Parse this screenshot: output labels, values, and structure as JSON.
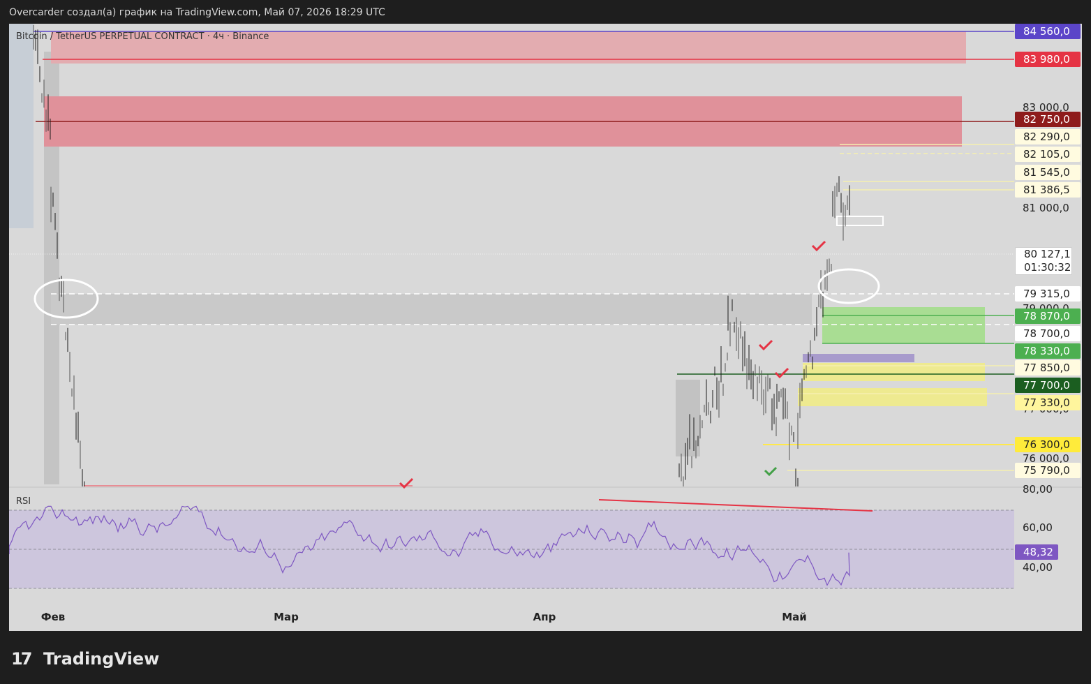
{
  "header": {
    "attribution": "Overcarder создал(а) график на TradingView.com, Май 07, 2026 18:29 UTC"
  },
  "chart": {
    "symbol_line": "Bitcoin / TetherUS PERPETUAL CONTRACT · 4ч · Binance",
    "indicator_label": "RSI",
    "months": [
      "Фев",
      "Мар",
      "Апр",
      "Май"
    ],
    "price_ticks": [
      "83 000,0",
      "81 000,0",
      "79 000,0",
      "77 000,0",
      "76 000,0"
    ],
    "rsi_ticks": [
      "80,00",
      "60,00",
      "40,00"
    ],
    "price_labels": [
      {
        "text": "84 560,0",
        "bg": "#5b45c8",
        "fg": "#ffffff"
      },
      {
        "text": "83 980,0",
        "bg": "#e53344",
        "fg": "#ffffff"
      },
      {
        "text": "82 750,0",
        "bg": "#8e1b1b",
        "fg": "#ffffff"
      },
      {
        "text": "82 290,0",
        "bg": "#fffbe0",
        "fg": "#222222"
      },
      {
        "text": "82 105,0",
        "bg": "#fffbe0",
        "fg": "#222222"
      },
      {
        "text": "81 545,0",
        "bg": "#fffbe0",
        "fg": "#222222"
      },
      {
        "text": "81 386,5",
        "bg": "#fffbe0",
        "fg": "#222222"
      },
      {
        "text": "79 315,0",
        "bg": "#ffffff",
        "fg": "#222222"
      },
      {
        "text": "78 870,0",
        "bg": "#4caf50",
        "fg": "#ffffff"
      },
      {
        "text": "78 700,0",
        "bg": "#ffffff",
        "fg": "#222222"
      },
      {
        "text": "78 330,0",
        "bg": "#4caf50",
        "fg": "#ffffff"
      },
      {
        "text": "77 850,0",
        "bg": "#fffbe0",
        "fg": "#222222"
      },
      {
        "text": "77 700,0",
        "bg": "#1b5e20",
        "fg": "#ffffff"
      },
      {
        "text": "77 330,0",
        "bg": "#fff59d",
        "fg": "#222222"
      },
      {
        "text": "76 300,0",
        "bg": "#ffeb3b",
        "fg": "#222222"
      },
      {
        "text": "75 790,0",
        "bg": "#fffbe0",
        "fg": "#222222"
      }
    ],
    "current_price": {
      "price": "80 127,1",
      "countdown": "01:30:32"
    },
    "rsi_value": {
      "text": "48,32",
      "bg": "#7e57c2"
    }
  },
  "chart_data": {
    "type": "line",
    "x_ticks": [
      "Фев",
      "Мар",
      "Апр",
      "Май"
    ],
    "ylim": [
      75600,
      85000
    ],
    "levels": [
      84560,
      83980,
      82750,
      82290,
      82105,
      81545,
      81386.5,
      79315,
      78870,
      78700,
      78330,
      77850,
      77700,
      77330,
      76300,
      75790
    ],
    "current_price": 80127.1,
    "series": [
      {
        "values": [
          {
            "x": "2026-04-26",
            "y": 79300
          },
          {
            "x": "2026-04-28",
            "y": 77300
          },
          {
            "x": "2026-04-30",
            "y": 76600
          },
          {
            "x": "2026-05-01",
            "y": 75800
          },
          {
            "x": "2026-05-02",
            "y": 77500
          },
          {
            "x": "2026-05-03",
            "y": 78400
          },
          {
            "x": "2026-05-04",
            "y": 79800
          },
          {
            "x": "2026-05-05",
            "y": 81400
          },
          {
            "x": "2026-05-06",
            "y": 82700
          },
          {
            "x": "2026-05-07",
            "y": 80127.1
          }
        ]
      }
    ],
    "rsi": {
      "ylim": [
        20,
        90
      ],
      "guide_levels": [
        70,
        50,
        30
      ],
      "last": 48.32
    }
  },
  "brand": {
    "name": "TradingView",
    "mark": "17"
  }
}
